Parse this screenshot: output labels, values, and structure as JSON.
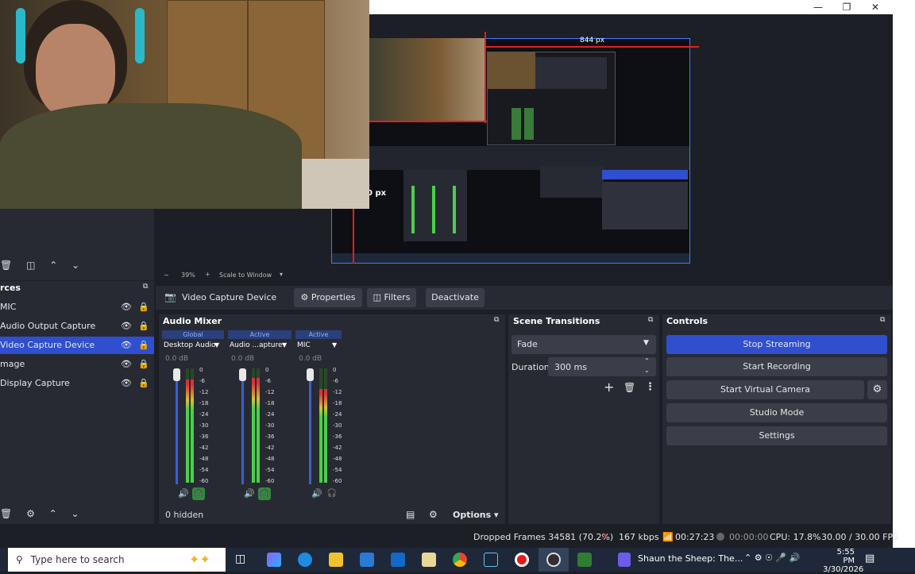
{
  "preview": {
    "width_label": "844 px",
    "side_label": "0 px",
    "zoom_level": "39%",
    "scale_mode": "Scale to Window"
  },
  "context": {
    "source_name": "Video Capture Device",
    "properties_label": "Properties",
    "filters_label": "Filters",
    "deactivate_label": "Deactivate"
  },
  "sources": {
    "title": "rces",
    "items": [
      {
        "label": "MIC",
        "selected": false
      },
      {
        "label": "Audio Output Capture",
        "selected": false
      },
      {
        "label": "Video Capture Device",
        "selected": true
      },
      {
        "label": "mage",
        "selected": false
      },
      {
        "label": "Display Capture",
        "selected": false
      }
    ],
    "hidden_count": "0 hidden"
  },
  "mixer": {
    "title": "Audio Mixer",
    "scale_ticks": [
      "0",
      "-6",
      "-12",
      "-18",
      "-24",
      "-30",
      "-36",
      "-42",
      "-48",
      "-54",
      "-60"
    ],
    "channels": [
      {
        "badge": "Global",
        "name": "Desktop Audio",
        "db": "0.0 dB",
        "level": 0.9
      },
      {
        "badge": "Active",
        "name": "Audio ...apture",
        "db": "0.0 dB",
        "level": 0.92
      },
      {
        "badge": "Active",
        "name": "MIC",
        "db": "0.0 dB",
        "level": 0.82
      }
    ],
    "options_label": "Options"
  },
  "transitions": {
    "title": "Scene Transitions",
    "selected": "Fade",
    "duration_label": "Duration",
    "duration_value": "300 ms"
  },
  "controls": {
    "title": "Controls",
    "stop_streaming": "Stop Streaming",
    "start_recording": "Start Recording",
    "start_virtual_camera": "Start Virtual Camera",
    "studio_mode": "Studio Mode",
    "settings": "Settings"
  },
  "statusbar": {
    "dropped_frames": "Dropped Frames 34581 (70.2%)",
    "bitrate": "167 kbps",
    "stream_time": "00:27:23",
    "rec_time": "00:00:00",
    "cpu": "CPU: 17.8%",
    "fps": "30.00 / 30.00 FPS"
  },
  "taskbar": {
    "search_placeholder": "Type here to search",
    "active_window": "Shaun the Sheep: The...",
    "time": "5:55 PM",
    "date": "3/30/2026"
  },
  "colors": {
    "accent": "#2f4fcf",
    "panel": "#272a33",
    "bg": "#1d1f26",
    "meter_green": "#4ad04a",
    "meter_yellow": "#d8c233",
    "meter_red": "#d8333a"
  }
}
